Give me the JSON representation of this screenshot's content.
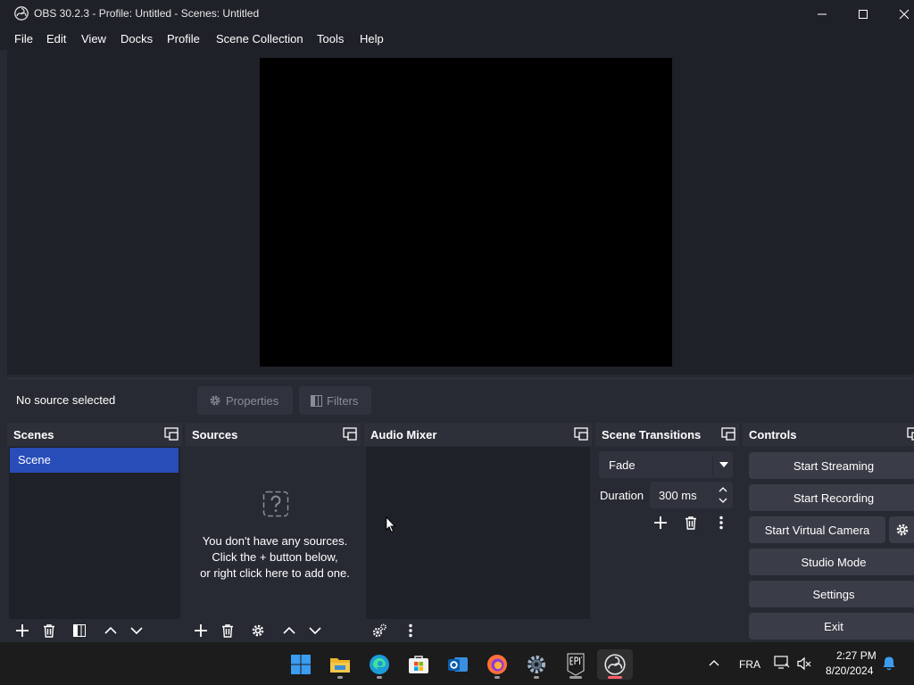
{
  "window": {
    "title": "OBS 30.2.3 - Profile: Untitled - Scenes: Untitled",
    "menu": [
      "File",
      "Edit",
      "View",
      "Docks",
      "Profile",
      "Scene Collection",
      "Tools",
      "Help"
    ]
  },
  "context_bar": {
    "status": "No source selected",
    "properties_label": "Properties",
    "filters_label": "Filters"
  },
  "docks": {
    "scenes": {
      "title": "Scenes",
      "items": [
        "Scene"
      ]
    },
    "sources": {
      "title": "Sources",
      "empty_line1": "You don't have any sources.",
      "empty_line2": "Click the + button below,",
      "empty_line3": "or right click here to add one."
    },
    "audio_mixer": {
      "title": "Audio Mixer"
    },
    "scene_transitions": {
      "title": "Scene Transitions",
      "transition": "Fade",
      "duration_label": "Duration",
      "duration_value": "300 ms"
    },
    "controls": {
      "title": "Controls",
      "start_streaming": "Start Streaming",
      "start_recording": "Start Recording",
      "start_virtual_camera": "Start Virtual Camera",
      "studio_mode": "Studio Mode",
      "settings": "Settings",
      "exit": "Exit"
    }
  },
  "taskbar": {
    "apps": [
      "windows-start",
      "file-explorer",
      "edge",
      "microsoft-store",
      "outlook",
      "firefox",
      "settings",
      "epic-games",
      "obs-studio"
    ],
    "language": "FRA",
    "time": "2:27 PM",
    "date": "8/20/2024"
  },
  "colors": {
    "selected_scene": "#284cb8",
    "background": "#272a33",
    "panel": "#1f2128",
    "button": "#3a3d47"
  }
}
